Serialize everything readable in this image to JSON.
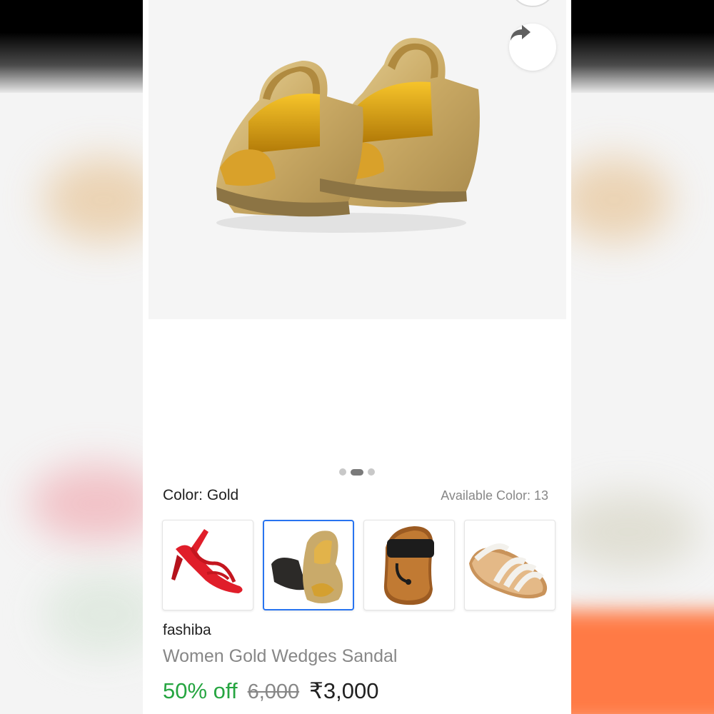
{
  "product": {
    "brand": "fashiba",
    "title": "Women Gold Wedges Sandal",
    "discount": "50% off",
    "mrp": "6,000",
    "price": "₹3,000"
  },
  "gallery": {
    "image": "gold-wedge-sandal-photo",
    "page_count": 3,
    "active_page": 2
  },
  "actions": {
    "share_icon": "share-arrow-icon"
  },
  "color_picker": {
    "label": "Color: Gold",
    "available": "Available Color: 13",
    "options": [
      {
        "name": "red-strappy-heel",
        "selected": false
      },
      {
        "name": "gold-wedge-sandal",
        "selected": true
      },
      {
        "name": "black-brown-kolhapuri",
        "selected": false
      },
      {
        "name": "white-flat-sandal",
        "selected": false
      }
    ],
    "selected_border_color": "#2874f0"
  },
  "colors": {
    "discount": "#26a541",
    "muted_text": "#878787",
    "primary_text": "#212121"
  }
}
